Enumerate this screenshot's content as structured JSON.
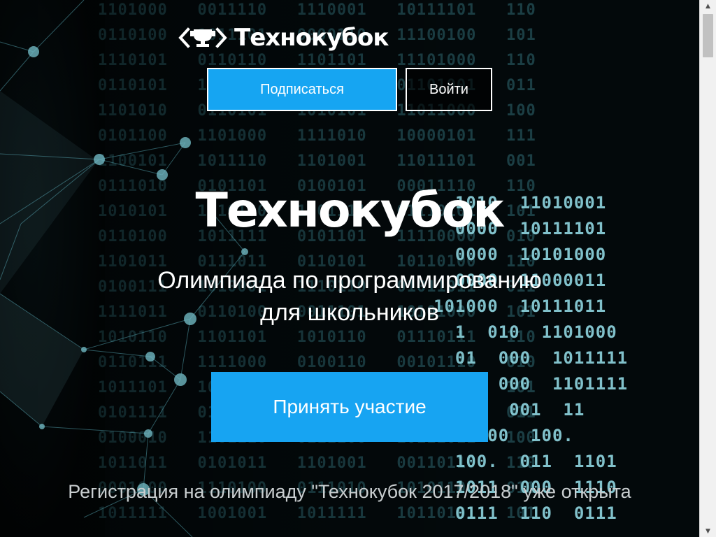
{
  "header": {
    "logo_text": "Технокубок",
    "logo_icon": "code-cup-icon",
    "subscribe_label": "Подписаться",
    "login_label": "Войти"
  },
  "hero": {
    "title": "Технокубок",
    "subtitle_line1": "Олимпиада по программированию",
    "subtitle_line2": "для школьников",
    "cta_label": "Принять участие",
    "notice": "Регистрация на олимпиаду \"Технокубок 2017/2018\" уже открыта"
  },
  "background": {
    "matrix_rows": [
      "1101000   0011110   1110001   10111101   110",
      "0110100   1011101   0000110   11100100   101",
      "1110101   0110110   1101101   11101000   110",
      "0110101   1101110   1011011   01101001   011",
      "1101010   0110101   1010101   11011000   100",
      "0101100   1101000   1111010   10000101   111",
      "1100101   1011110   1101001   11011101   001",
      "0111010   0101101   0100101   00011110   110",
      "1010101   1110100   1001111   01110101   101",
      "0110100   1011111   0101101   11110000   010",
      "1101011   0111011   0110101   10110100   110",
      "0100111   1010001   1110110   01011011   011",
      "1111011   0110100   0011101   10101000   101",
      "1010110   1101101   1010110   01110111   110",
      "0110111   1111000   0100110   00101110   010",
      "1011101   1000110   1011101   01111011   101",
      "0101111   0111010   1100100   11010110   011",
      "0100010   1101110   0111100   10111011   100",
      "1011011   0101011   1101001   00110110   110",
      "0001000   1110100   0111010   10101100   011",
      "1011111   1001001   1011111   10110101   101"
    ],
    "bright_rows": [
      "  1010  11010001",
      "  0000  10111101",
      "  0000  10101000",
      "  0000  11000011",
      "101000  10111011",
      "  1  010  1101000",
      "  01  000  1011111",
      "  0   000  1101111",
      "  001  001  11",
      "    000  100.",
      "  100.  011  1101",
      "  1011  000  1110",
      "  0111  110  0111"
    ]
  },
  "scrollbar": {
    "up_icon": "scroll-up-arrow-icon",
    "down_icon": "scroll-down-arrow-icon"
  }
}
